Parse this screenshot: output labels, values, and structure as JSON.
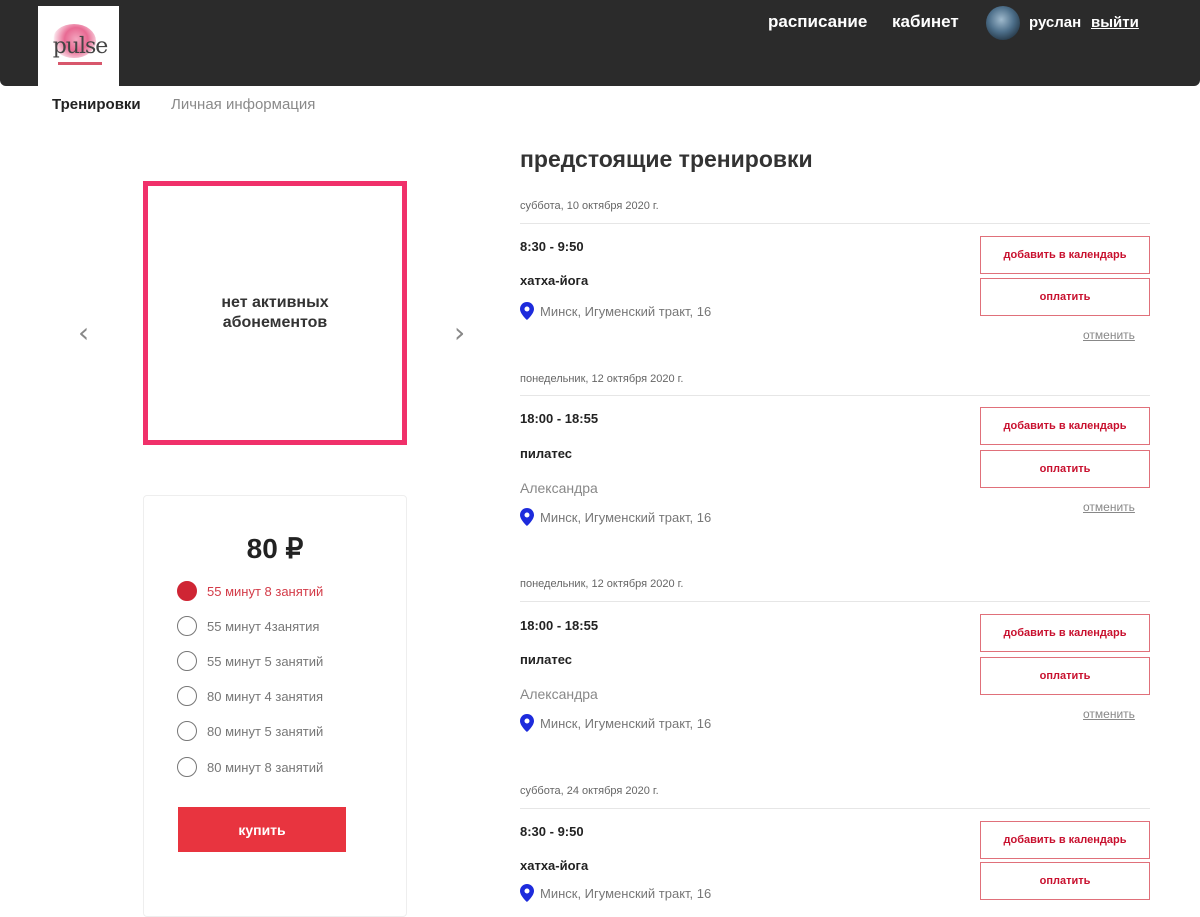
{
  "header": {
    "logo_text": "pulse",
    "nav": [
      "расписание",
      "кабинет"
    ],
    "username": "руслан",
    "logout": "выйти"
  },
  "tabs": {
    "active": "Тренировки",
    "inactive": "Личная информация"
  },
  "subscription": {
    "empty_message": "нет активных абонементов",
    "prev_arrow": "‹",
    "next_arrow": "›"
  },
  "pricing": {
    "price": "80 ₽",
    "selected_index": 0,
    "options": [
      "55 минут 8 занятий",
      "55 минут 4занятия",
      "55 минут 5 занятий",
      "80 минут 4 занятия",
      "80 минут 5 занятий",
      "80 минут 8 занятий"
    ],
    "buy_label": "купить"
  },
  "upcoming": {
    "title": "предстоящие тренировки",
    "add_calendar_label": "добавить в календарь",
    "pay_label": "оплатить",
    "cancel_label": "отменить",
    "sessions": [
      {
        "date": "суббота, 10 октября 2020 г.",
        "time": "8:30 - 9:50",
        "class": "хатха-йога",
        "coach": "",
        "location": "Минск, Игуменский тракт, 16"
      },
      {
        "date": "понедельник, 12 октября 2020 г.",
        "time": "18:00 - 18:55",
        "class": "пилатес",
        "coach": "Александра",
        "location": "Минск, Игуменский тракт, 16"
      },
      {
        "date": "понедельник, 12 октября 2020 г.",
        "time": "18:00 - 18:55",
        "class": "пилатес",
        "coach": "Александра",
        "location": "Минск, Игуменский тракт, 16"
      },
      {
        "date": "суббота, 24 октября 2020 г.",
        "time": "8:30 - 9:50",
        "class": "хатха-йога",
        "coach": "",
        "location": "Минск, Игуменский тракт, 16"
      }
    ]
  },
  "colors": {
    "accent_pink": "#f0306a",
    "accent_red": "#e8343f",
    "topbar": "#2b2b2b"
  },
  "icons": [
    "location-pin-icon",
    "chevron-left-icon",
    "chevron-right-icon",
    "avatar"
  ]
}
